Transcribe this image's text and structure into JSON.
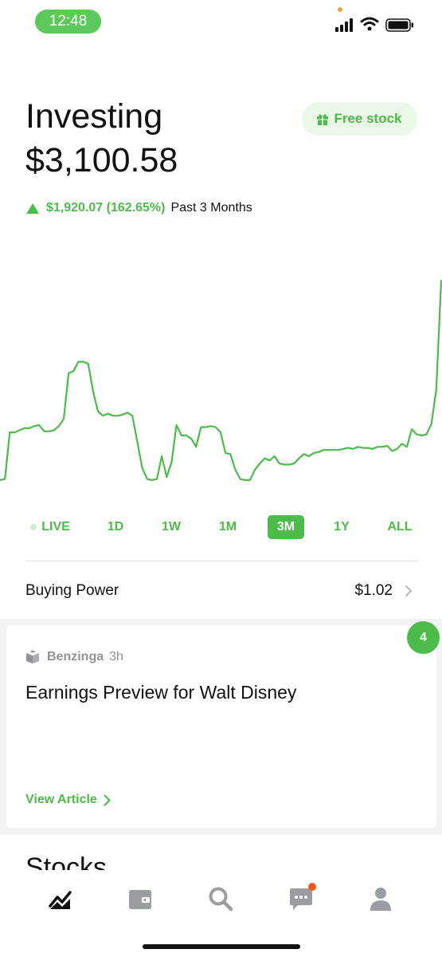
{
  "status_bar": {
    "time": "12:48"
  },
  "colors": {
    "accent": "#4cbb4a",
    "accent_light": "#e9f8e7",
    "notification": "#ee5a24",
    "muted": "#8f9398"
  },
  "header": {
    "title": "Investing",
    "balance": "$3,100.58",
    "free_stock_label": "Free stock",
    "change_value": "$1,920.07 (162.65%)",
    "change_period": "Past 3 Months",
    "change_direction": "up"
  },
  "chart_data": {
    "type": "line",
    "title": "",
    "xlabel": "",
    "ylabel": "",
    "grid": false,
    "color": "#4cbb4a",
    "x": [
      0,
      1,
      2,
      3,
      4,
      5,
      6,
      7,
      8,
      9,
      10,
      11,
      12,
      13,
      14,
      15,
      16,
      17,
      18,
      19,
      20,
      21,
      22,
      23,
      24,
      25,
      26,
      27,
      28,
      29,
      30,
      31,
      32,
      33,
      34,
      35,
      36,
      37,
      38,
      39,
      40,
      41,
      42,
      43,
      44,
      45,
      46,
      47,
      48,
      49,
      50,
      51,
      52,
      53,
      54,
      55,
      56,
      57,
      58,
      59,
      60,
      61,
      62,
      63,
      64,
      65,
      66,
      67,
      68,
      69,
      70,
      71,
      72,
      73,
      74,
      75,
      76,
      77,
      78,
      79,
      80,
      81,
      82,
      83,
      84,
      85,
      86,
      87,
      88,
      89,
      90
    ],
    "values": [
      1180,
      1190,
      1640,
      1640,
      1660,
      1680,
      1680,
      1700,
      1710,
      1650,
      1650,
      1660,
      1700,
      1770,
      2210,
      2230,
      2320,
      2320,
      2300,
      2030,
      1840,
      1800,
      1820,
      1800,
      1800,
      1810,
      1830,
      1800,
      1550,
      1300,
      1190,
      1180,
      1190,
      1410,
      1210,
      1350,
      1710,
      1610,
      1610,
      1580,
      1500,
      1690,
      1690,
      1700,
      1690,
      1640,
      1440,
      1430,
      1280,
      1190,
      1180,
      1180,
      1280,
      1340,
      1390,
      1370,
      1410,
      1340,
      1330,
      1330,
      1340,
      1390,
      1430,
      1410,
      1440,
      1450,
      1470,
      1470,
      1470,
      1470,
      1480,
      1490,
      1480,
      1500,
      1490,
      1490,
      1480,
      1500,
      1500,
      1510,
      1460,
      1480,
      1530,
      1500,
      1670,
      1620,
      1610,
      1620,
      1720,
      2050,
      3100
    ],
    "ylim": [
      1180,
      3100
    ]
  },
  "ranges": [
    {
      "label": "LIVE",
      "active": false
    },
    {
      "label": "1D",
      "active": false
    },
    {
      "label": "1W",
      "active": false
    },
    {
      "label": "1M",
      "active": false
    },
    {
      "label": "3M",
      "active": true
    },
    {
      "label": "1Y",
      "active": false
    },
    {
      "label": "ALL",
      "active": false
    }
  ],
  "buying_power": {
    "label": "Buying Power",
    "value": "$1.02"
  },
  "news": {
    "badge_count": "4",
    "source": "Benzinga",
    "time": "3h",
    "headline": "Earnings Preview for Walt Disney",
    "cta": "View Article"
  },
  "stocks": {
    "heading": "Stocks"
  },
  "tabs": [
    {
      "icon": "chart-icon",
      "active": true
    },
    {
      "icon": "wallet-icon",
      "active": false
    },
    {
      "icon": "search-icon",
      "active": false
    },
    {
      "icon": "messages-icon",
      "active": false,
      "has_notification": true
    },
    {
      "icon": "account-icon",
      "active": false
    }
  ]
}
